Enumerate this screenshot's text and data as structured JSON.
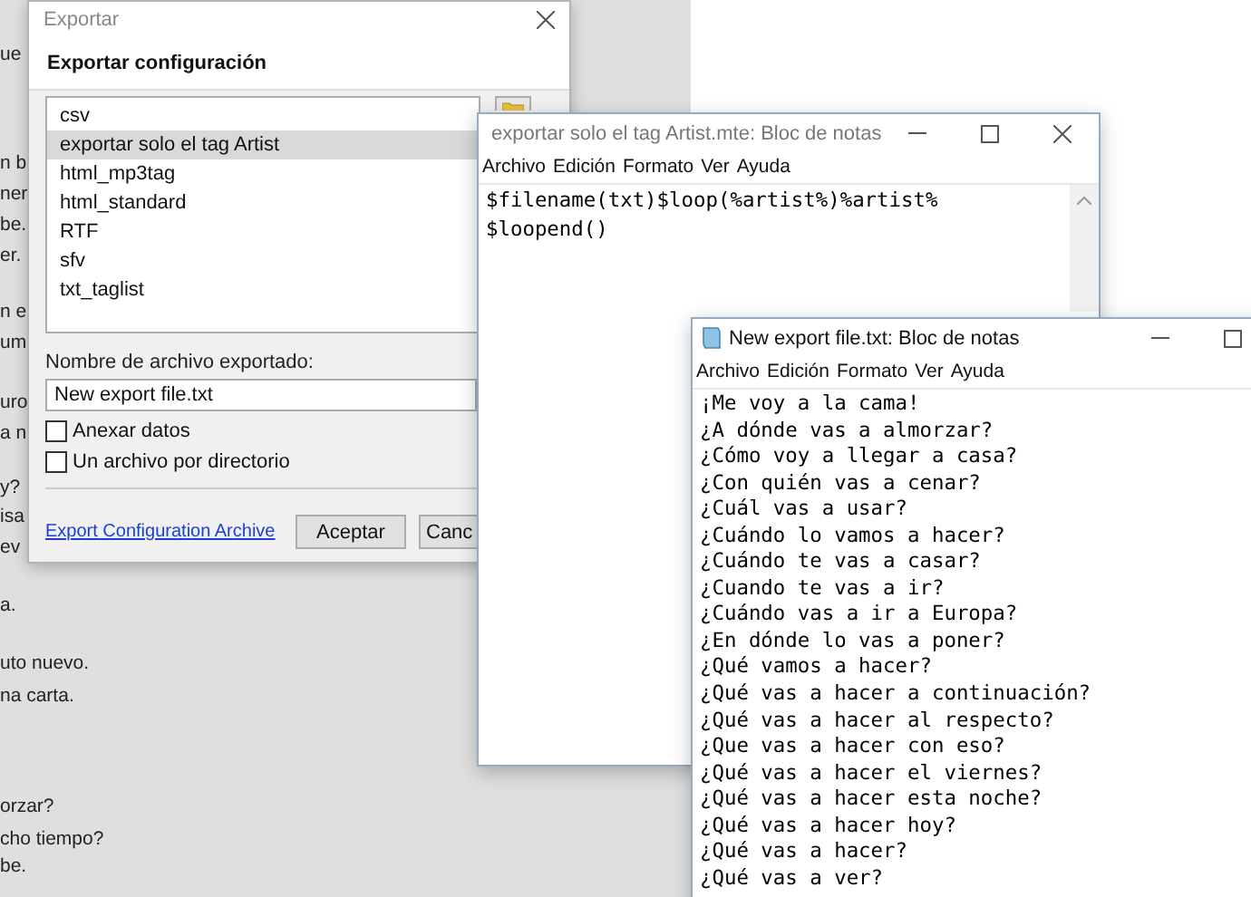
{
  "background_document": {
    "lines": [
      "ue",
      "n b",
      "ner",
      "be.",
      "er.",
      "n e",
      "um",
      "uro",
      "a n",
      "y?",
      "isa",
      "ev",
      "a.",
      "uto nuevo.",
      "na carta.",
      "orzar?",
      "cho tiempo?",
      "be."
    ]
  },
  "export_dialog": {
    "title": "Exportar",
    "heading": "Exportar configuración",
    "configurations": [
      {
        "label": "csv",
        "selected": false
      },
      {
        "label": "exportar solo el tag Artist",
        "selected": true
      },
      {
        "label": "html_mp3tag",
        "selected": false
      },
      {
        "label": "html_standard",
        "selected": false
      },
      {
        "label": "RTF",
        "selected": false
      },
      {
        "label": "sfv",
        "selected": false
      },
      {
        "label": "txt_taglist",
        "selected": false
      }
    ],
    "filename_label": "Nombre de archivo exportado:",
    "filename": {
      "value": "New export file.txt"
    },
    "options": [
      {
        "label": "Anexar datos",
        "checked": false
      },
      {
        "label": "Un archivo por directorio",
        "checked": false
      }
    ],
    "link": "Export Configuration Archive",
    "buttons": [
      "Aceptar",
      "Canc"
    ]
  },
  "notepads": [
    {
      "title": "exportar solo el tag Artist.mte: Bloc de notas",
      "active": false,
      "scrollbar": true,
      "window_buttons": [
        {
          "kind": "minimize"
        },
        {
          "kind": "maximize"
        },
        {
          "kind": "close"
        }
      ],
      "menu": [
        "Archivo",
        "Edición",
        "Formato",
        "Ver",
        "Ayuda"
      ],
      "lines": [
        "$filename(txt)$loop(%artist%)%artist%",
        "$loopend()"
      ]
    },
    {
      "title": "New export file.txt: Bloc de notas",
      "active": true,
      "scrollbar": false,
      "window_buttons": [
        {
          "kind": "minimize"
        },
        {
          "kind": "maximize"
        }
      ],
      "menu": [
        "Archivo",
        "Edición",
        "Formato",
        "Ver",
        "Ayuda"
      ],
      "lines": [
        "¡Me voy a la cama!",
        "¿A dónde vas a almorzar?",
        "¿Cómo voy a llegar a casa?",
        "¿Con quién vas a cenar?",
        "¿Cuál vas a usar?",
        "¿Cuándo lo vamos a hacer?",
        "¿Cuándo te vas a casar?",
        "¿Cuando te vas a ir?",
        "¿Cuándo vas a ir a Europa?",
        "¿En dónde lo vas a poner?",
        "¿Qué vamos a hacer?",
        "¿Qué vas a hacer a continuación?",
        "¿Qué vas a hacer al respecto?",
        "¿Que vas a hacer con eso?",
        "¿Qué vas a hacer el viernes?",
        "¿Qué vas a hacer esta noche?",
        "¿Qué vas a hacer hoy?",
        "¿Qué vas a hacer?",
        "¿Qué vas a ver?"
      ]
    }
  ]
}
